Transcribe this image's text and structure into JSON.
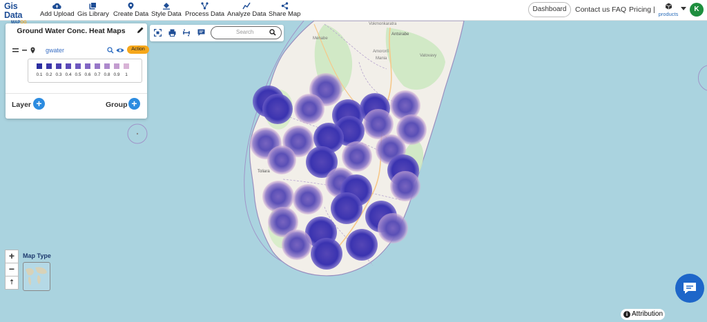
{
  "app": {
    "logo_line1": "Gis Data",
    "logo_line2_a": "MAP",
    "logo_line2_b": "OG"
  },
  "nav": {
    "add_upload": "Add Upload",
    "gis_library": "Gis Library",
    "create_data": "Create Data",
    "style_data": "Style Data",
    "process_data": "Process Data",
    "analyze_data": "Analyze Data",
    "share_map": "Share Map"
  },
  "header_right": {
    "dashboard": "Dashboard",
    "contact": "Contact us",
    "faq": "FAQ",
    "pricing": "Pricing |",
    "products": "products",
    "avatar_initial": "K"
  },
  "layer_panel": {
    "title": "Ground Water Conc. Heat Maps",
    "layer_name": "gwater",
    "action_label": "Action",
    "legend_values": [
      "0.1",
      "0.2",
      "0.3",
      "0.4",
      "0.5",
      "0.6",
      "0.7",
      "0.8",
      "0.9",
      "1"
    ],
    "legend_colors": [
      "#2b2ea0",
      "#3b36a8",
      "#4b3fb0",
      "#5c4ab8",
      "#6e58bf",
      "#8266c4",
      "#9777c8",
      "#ad89cc",
      "#c39ccf",
      "#d8b3d6"
    ],
    "layer_label": "Layer",
    "group_label": "Group"
  },
  "toolbar": {
    "search_placeholder": "Search"
  },
  "map": {
    "zoom_in": "+",
    "zoom_out": "−",
    "reset": "⇡",
    "map_type_label": "Map Type",
    "place_labels": [
      "Mahajanga",
      "Vokmonkaratra",
      "Antsirabe",
      "Amoron'i",
      "Mania",
      "Menabe",
      "Vatovavy",
      "Toliara"
    ]
  },
  "attribution": "Attribution"
}
